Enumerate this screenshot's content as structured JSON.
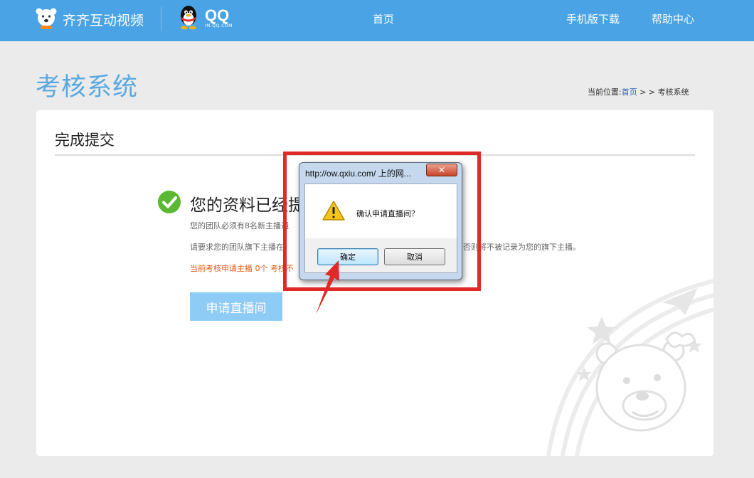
{
  "header": {
    "brand": "齐齐互动视频",
    "qq_logo": "QQ",
    "qq_logo_sub": "IM.QQ.COM",
    "nav": [
      "首页",
      "手机版下载",
      "帮助中心"
    ]
  },
  "page": {
    "title": "考核系统",
    "breadcrumb": {
      "prefix": "当前位置:",
      "home": "首页",
      "sep": " > > ",
      "current": "考核系统"
    }
  },
  "card": {
    "title": "完成提交",
    "success_title": "您的资料已经提",
    "info_line1": "您的团队必须有8名新主播通",
    "info_line2a": "请要求您的团队旗下主播在",
    "info_line2b": "否则将不被记录为您的旗下主播。",
    "warn_line": "当前考核申请主播 0个 考核不",
    "apply_button": "申请直播间"
  },
  "dialog": {
    "title": "http://ow.qxiu.com/ 上的网...",
    "close": "✕",
    "message": "确认申请直播间？",
    "ok": "确定",
    "cancel": "取消"
  },
  "icons": {
    "brand": "bear-logo-icon",
    "qq": "qq-penguin-icon",
    "success": "check-circle-icon",
    "warning": "warning-triangle-icon",
    "annotation": "red-arrow-icon"
  },
  "colors": {
    "header": "#4aa3e4",
    "title_blue": "#5aa8e0",
    "apply_button": "#8ecbf5",
    "success_green": "#5bb832",
    "warn_orange": "#e55a1a",
    "highlight_red": "#e02a2a"
  }
}
